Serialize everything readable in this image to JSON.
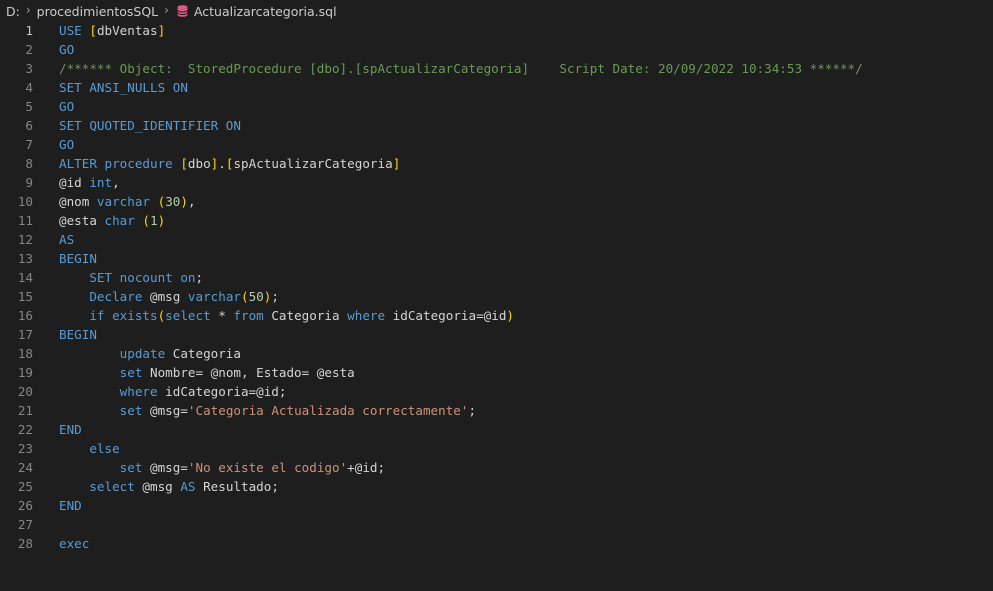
{
  "breadcrumb": {
    "drive": "D:",
    "folder": "procedimientosSQL",
    "file": "Actualizarcategoria.sql",
    "file_icon": "database-icon"
  },
  "editor": {
    "active_line": 1,
    "colors": {
      "background": "#1e1e1e",
      "keyword": "#569cd6",
      "bracket": "#ffd700",
      "comment": "#6a9955",
      "string": "#ce9178",
      "number": "#b5cea8",
      "text": "#d4d4d4",
      "line_number": "#858585"
    },
    "lines": [
      {
        "num": "1",
        "tokens": [
          {
            "t": "USE ",
            "c": "kw"
          },
          {
            "t": "[",
            "c": "br"
          },
          {
            "t": "dbVentas",
            "c": "vr"
          },
          {
            "t": "]",
            "c": "br"
          }
        ]
      },
      {
        "num": "2",
        "tokens": [
          {
            "t": "GO",
            "c": "kw"
          }
        ]
      },
      {
        "num": "3",
        "tokens": [
          {
            "t": "/****** Object:  StoredProcedure [dbo].[spActualizarCategoria]    Script Date: 20/09/2022 10:34:53 ******/",
            "c": "cm"
          }
        ]
      },
      {
        "num": "4",
        "tokens": [
          {
            "t": "SET ANSI_NULLS ON",
            "c": "kw"
          }
        ]
      },
      {
        "num": "5",
        "tokens": [
          {
            "t": "GO",
            "c": "kw"
          }
        ]
      },
      {
        "num": "6",
        "tokens": [
          {
            "t": "SET QUOTED_IDENTIFIER ON",
            "c": "kw"
          }
        ]
      },
      {
        "num": "7",
        "tokens": [
          {
            "t": "GO",
            "c": "kw"
          }
        ]
      },
      {
        "num": "8",
        "tokens": [
          {
            "t": "ALTER procedure ",
            "c": "kw"
          },
          {
            "t": "[",
            "c": "br"
          },
          {
            "t": "dbo",
            "c": "vr"
          },
          {
            "t": "]",
            "c": "br"
          },
          {
            "t": ".",
            "c": "pn"
          },
          {
            "t": "[",
            "c": "br"
          },
          {
            "t": "spActualizarCategoria",
            "c": "vr"
          },
          {
            "t": "]",
            "c": "br"
          }
        ]
      },
      {
        "num": "9",
        "tokens": [
          {
            "t": "@id ",
            "c": "vr"
          },
          {
            "t": "int",
            "c": "kw"
          },
          {
            "t": ",",
            "c": "pn"
          }
        ]
      },
      {
        "num": "10",
        "tokens": [
          {
            "t": "@nom ",
            "c": "vr"
          },
          {
            "t": "varchar ",
            "c": "kw"
          },
          {
            "t": "(",
            "c": "br"
          },
          {
            "t": "30",
            "c": "nm"
          },
          {
            "t": ")",
            "c": "br"
          },
          {
            "t": ",",
            "c": "pn"
          }
        ]
      },
      {
        "num": "11",
        "tokens": [
          {
            "t": "@esta ",
            "c": "vr"
          },
          {
            "t": "char ",
            "c": "kw"
          },
          {
            "t": "(",
            "c": "br"
          },
          {
            "t": "1",
            "c": "nm"
          },
          {
            "t": ")",
            "c": "br"
          }
        ]
      },
      {
        "num": "12",
        "tokens": [
          {
            "t": "AS",
            "c": "kw"
          }
        ]
      },
      {
        "num": "13",
        "tokens": [
          {
            "t": "BEGIN",
            "c": "kw"
          }
        ]
      },
      {
        "num": "14",
        "tokens": [
          {
            "t": "    SET nocount on",
            "c": "kw"
          },
          {
            "t": ";",
            "c": "pn"
          }
        ]
      },
      {
        "num": "15",
        "tokens": [
          {
            "t": "    Declare ",
            "c": "kw"
          },
          {
            "t": "@msg ",
            "c": "vr"
          },
          {
            "t": "varchar",
            "c": "kw"
          },
          {
            "t": "(",
            "c": "br"
          },
          {
            "t": "50",
            "c": "nm"
          },
          {
            "t": ")",
            "c": "br"
          },
          {
            "t": ";",
            "c": "pn"
          }
        ]
      },
      {
        "num": "16",
        "tokens": [
          {
            "t": "    if exists",
            "c": "kw"
          },
          {
            "t": "(",
            "c": "br"
          },
          {
            "t": "select ",
            "c": "kw"
          },
          {
            "t": "* ",
            "c": "pn"
          },
          {
            "t": "from ",
            "c": "kw"
          },
          {
            "t": "Categoria ",
            "c": "vr"
          },
          {
            "t": "where ",
            "c": "kw"
          },
          {
            "t": "idCategoria=@id",
            "c": "vr"
          },
          {
            "t": ")",
            "c": "br"
          }
        ]
      },
      {
        "num": "17",
        "tokens": [
          {
            "t": "BEGIN",
            "c": "kw"
          }
        ]
      },
      {
        "num": "18",
        "tokens": [
          {
            "t": "        update ",
            "c": "kw"
          },
          {
            "t": "Categoria",
            "c": "vr"
          }
        ]
      },
      {
        "num": "19",
        "tokens": [
          {
            "t": "        set ",
            "c": "kw"
          },
          {
            "t": "Nombre= @nom, Estado= @esta",
            "c": "vr"
          }
        ]
      },
      {
        "num": "20",
        "tokens": [
          {
            "t": "        where ",
            "c": "kw"
          },
          {
            "t": "idCategoria=@id;",
            "c": "vr"
          }
        ]
      },
      {
        "num": "21",
        "tokens": [
          {
            "t": "        set ",
            "c": "kw"
          },
          {
            "t": "@msg=",
            "c": "vr"
          },
          {
            "t": "'Categoria Actualizada correctamente'",
            "c": "st"
          },
          {
            "t": ";",
            "c": "pn"
          }
        ]
      },
      {
        "num": "22",
        "tokens": [
          {
            "t": "END",
            "c": "kw"
          }
        ]
      },
      {
        "num": "23",
        "tokens": [
          {
            "t": "    else",
            "c": "kw"
          }
        ]
      },
      {
        "num": "24",
        "tokens": [
          {
            "t": "        set ",
            "c": "kw"
          },
          {
            "t": "@msg=",
            "c": "vr"
          },
          {
            "t": "'No existe el codigo'",
            "c": "st"
          },
          {
            "t": "+@id;",
            "c": "vr"
          }
        ]
      },
      {
        "num": "25",
        "tokens": [
          {
            "t": "    select ",
            "c": "kw"
          },
          {
            "t": "@msg ",
            "c": "vr"
          },
          {
            "t": "AS ",
            "c": "kw"
          },
          {
            "t": "Resultado;",
            "c": "vr"
          }
        ]
      },
      {
        "num": "26",
        "tokens": [
          {
            "t": "END",
            "c": "kw"
          }
        ]
      },
      {
        "num": "27",
        "tokens": []
      },
      {
        "num": "28",
        "tokens": [
          {
            "t": "exec",
            "c": "kw"
          }
        ]
      }
    ]
  }
}
